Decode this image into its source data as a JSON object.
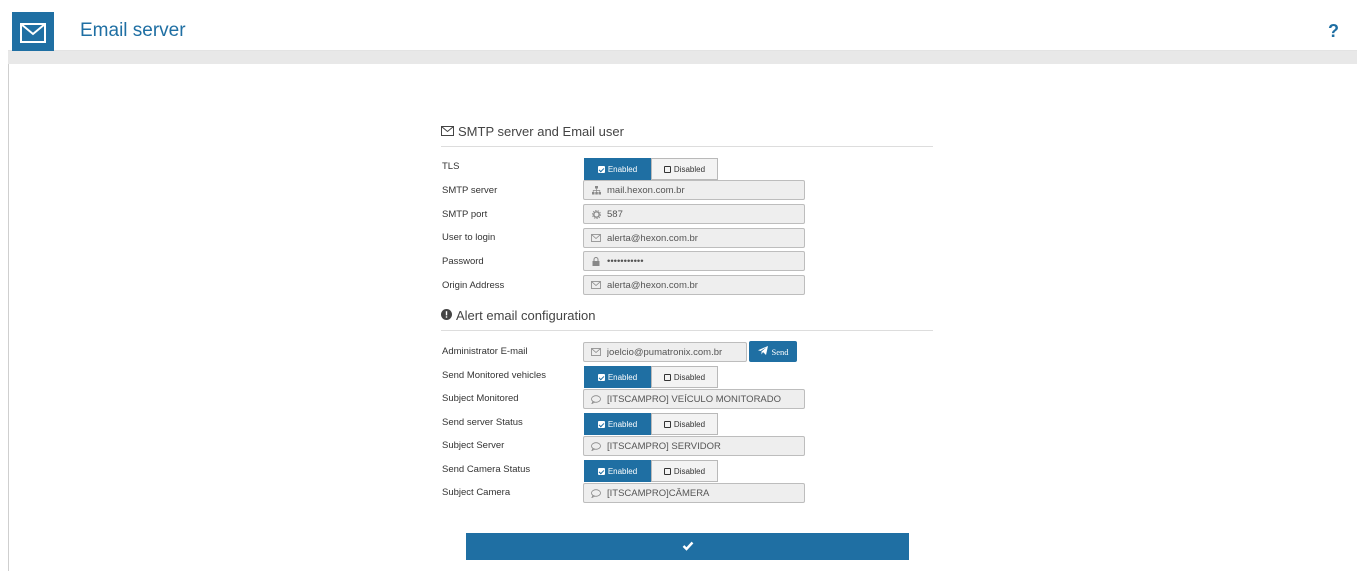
{
  "header": {
    "title": "Email server",
    "help_label": "?",
    "icon": "envelope-icon"
  },
  "smtp_section": {
    "heading": "SMTP server and Email user",
    "tls": {
      "label": "TLS",
      "enabled_label": "Enabled",
      "disabled_label": "Disabled",
      "selected": "Enabled"
    },
    "smtp_server": {
      "label": "SMTP server",
      "value": "mail.hexon.com.br",
      "icon": "sitemap-icon"
    },
    "smtp_port": {
      "label": "SMTP port",
      "value": "587",
      "icon": "gear-icon"
    },
    "user_login": {
      "label": "User to login",
      "value": "alerta@hexon.com.br",
      "icon": "envelope-icon"
    },
    "password": {
      "label": "Password",
      "value": "•••••••••••",
      "icon": "lock-icon"
    },
    "origin_address": {
      "label": "Origin Address",
      "value": "alerta@hexon.com.br",
      "icon": "envelope-icon"
    }
  },
  "alert_section": {
    "heading": "Alert email configuration",
    "admin_email": {
      "label": "Administrator E-mail",
      "value": "joelcio@pumatronix.com.br",
      "send_label": "Send"
    },
    "send_monitored": {
      "label": "Send Monitored vehicles",
      "enabled_label": "Enabled",
      "disabled_label": "Disabled",
      "selected": "Enabled"
    },
    "subject_monitored": {
      "label": "Subject Monitored",
      "value": "[ITSCAMPRO] VEÍCULO MONITORADO"
    },
    "send_server_status": {
      "label": "Send server Status",
      "enabled_label": "Enabled",
      "disabled_label": "Disabled",
      "selected": "Enabled"
    },
    "subject_server": {
      "label": "Subject Server",
      "value": "[ITSCAMPRO] SERVIDOR"
    },
    "send_camera_status": {
      "label": "Send Camera Status",
      "enabled_label": "Enabled",
      "disabled_label": "Disabled",
      "selected": "Enabled"
    },
    "subject_camera": {
      "label": "Subject Camera",
      "value": "[ITSCAMPRO]CÂMERA"
    }
  },
  "colors": {
    "accent": "#1f6fa3",
    "field_bg": "#eeeeee"
  }
}
